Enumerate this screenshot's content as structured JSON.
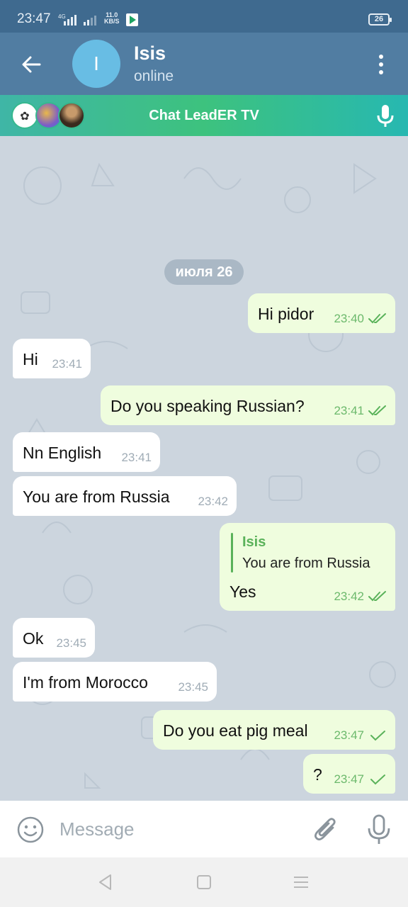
{
  "status_bar": {
    "time": "23:47",
    "network": "4G",
    "speed_value": "11.0",
    "speed_unit": "KB/S",
    "battery": "26"
  },
  "header": {
    "avatar_letter": "I",
    "name": "Isis",
    "status": "online"
  },
  "voice_chat": {
    "title": "Chat LeadER TV"
  },
  "date_separator": "июля 26",
  "messages": [
    {
      "dir": "out",
      "text": "Hi pidor",
      "time": "23:40",
      "ticks": "double"
    },
    {
      "dir": "in",
      "text": "Hi",
      "time": "23:41"
    },
    {
      "dir": "out",
      "text": "Do you speaking Russian?",
      "time": "23:41",
      "ticks": "double"
    },
    {
      "dir": "in",
      "text": "Nn English",
      "time": "23:41"
    },
    {
      "dir": "in",
      "text": "You are from Russia",
      "time": "23:42"
    },
    {
      "dir": "out",
      "reply_to_name": "Isis",
      "reply_to_text": "You are from Russia",
      "text": "Yes",
      "time": "23:42",
      "ticks": "double"
    },
    {
      "dir": "in",
      "text": "Ok",
      "time": "23:45"
    },
    {
      "dir": "in",
      "text": "I'm from Morocco",
      "time": "23:45"
    },
    {
      "dir": "out",
      "text": "Do you eat pig meal",
      "time": "23:47",
      "ticks": "single"
    },
    {
      "dir": "out",
      "text": "?",
      "time": "23:47",
      "ticks": "single"
    }
  ],
  "input": {
    "placeholder": "Message"
  },
  "colors": {
    "header": "#517da2",
    "status_bar": "#3f6a8f",
    "outgoing_bubble": "#effdde",
    "incoming_bubble": "#ffffff",
    "check_green": "#5ab25a",
    "voice_bar_start": "#3fb6a6",
    "voice_bar_end": "#27b8b1"
  },
  "icons": [
    "back-arrow-icon",
    "more-vert-icon",
    "microphone-icon",
    "emoji-icon",
    "attach-icon",
    "double-check-icon",
    "single-check-icon"
  ]
}
